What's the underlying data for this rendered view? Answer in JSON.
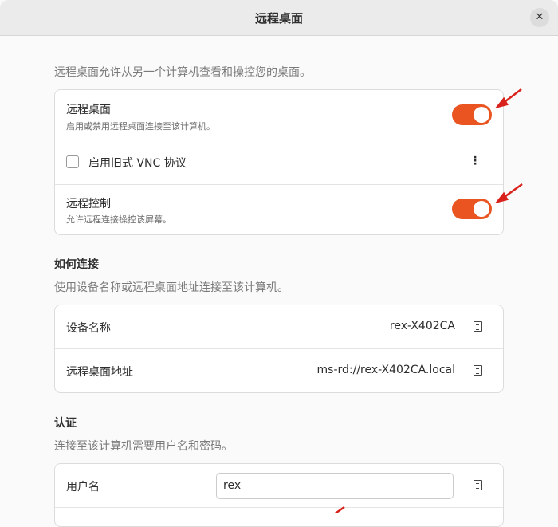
{
  "header": {
    "title": "远程桌面",
    "close_icon": "close-icon"
  },
  "intro": "远程桌面允许从另一个计算机查看和操控您的桌面。",
  "toggles": [
    {
      "label": "远程桌面",
      "sublabel": "启用或禁用远程桌面连接至该计算机。",
      "on": true
    },
    {
      "label": "启用旧式 VNC 协议",
      "checked": false
    },
    {
      "label": "远程控制",
      "sublabel": "允许远程连接操控该屏幕。",
      "on": true
    }
  ],
  "connect": {
    "heading": "如何连接",
    "desc": "使用设备名称或远程桌面地址连接至该计算机。",
    "rows": [
      {
        "label": "设备名称",
        "value": "rex-X402CA"
      },
      {
        "label": "远程桌面地址",
        "value": "ms-rd://rex-X402CA.local"
      }
    ]
  },
  "auth": {
    "heading": "认证",
    "desc": "连接至该计算机需要用户名和密码。",
    "username_label": "用户名",
    "username_value": "rex"
  },
  "accent": "#e95420"
}
